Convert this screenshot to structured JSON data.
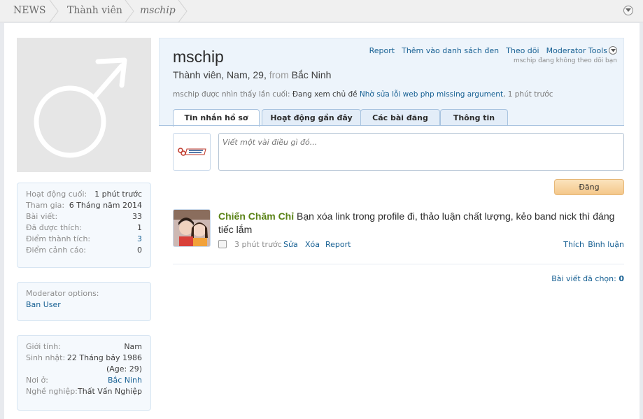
{
  "breadcrumb": {
    "items": [
      "NEWS",
      "Thành viên",
      "mschip"
    ]
  },
  "profile": {
    "username": "mschip",
    "blurb_title": "Thành viên, Nam, 29,",
    "blurb_from": "from",
    "blurb_location": "Bắc Ninh",
    "last_seen_prefix": "mschip được nhìn thấy lần cuối:",
    "last_seen_action": "Đang xem chủ đề",
    "last_seen_thread": "Nhờ sửa lỗi web php missing argument",
    "last_seen_time": ", 1 phút trước"
  },
  "actions": {
    "report": "Report",
    "ignore": "Thêm vào danh sách đen",
    "follow": "Theo dõi",
    "moderator_tools": "Moderator Tools",
    "follow_note": "mschip đang không theo dõi bạn"
  },
  "tabs": [
    "Tin nhắn hồ sơ",
    "Hoạt động gần đây",
    "Các bài đăng",
    "Thông tin"
  ],
  "composer": {
    "placeholder": "Viết một vài điều gì đó...",
    "post_label": "Đăng"
  },
  "stats": [
    {
      "label": "Hoạt động cuối:",
      "value": "1 phút trước"
    },
    {
      "label": "Tham gia:",
      "value": "6 Tháng năm 2014"
    },
    {
      "label": "Bài viết:",
      "value": "33"
    },
    {
      "label": "Đã được thích:",
      "value": "1"
    },
    {
      "label": "Điểm thành tích:",
      "value": "3"
    },
    {
      "label": "Điểm cảnh cáo:",
      "value": "0"
    }
  ],
  "moderator": {
    "title": "Moderator options:",
    "ban_user": "Ban User"
  },
  "info": [
    {
      "label": "Giới tính:",
      "value": "Nam"
    },
    {
      "label": "Sinh nhật:",
      "value": "22 Tháng bảy 1986"
    },
    {
      "label": "",
      "value": "(Age: 29)"
    },
    {
      "label": "Nơi ở:",
      "value": "Bắc Ninh"
    },
    {
      "label": "Nghề nghiệp:",
      "value": "Thất Vấn Nghiệp"
    }
  ],
  "message": {
    "author": "Chiến Chăm Chỉ",
    "text": "Bạn xóa link trong profile đi, thảo luận chất lượng, kẻo band nick thì đáng tiếc lắm",
    "time": "3 phút trước",
    "edit": "Sửa",
    "delete": "Xóa",
    "report": "Report",
    "like": "Thích",
    "comment": "Bình luận"
  },
  "selected_posts": {
    "label": "Bài viết đã chọn:",
    "count": "0"
  },
  "colors": {
    "link": "#176093",
    "author": "#598215",
    "header_bg": "#edf4fb",
    "post_button": "#f4c78a"
  }
}
